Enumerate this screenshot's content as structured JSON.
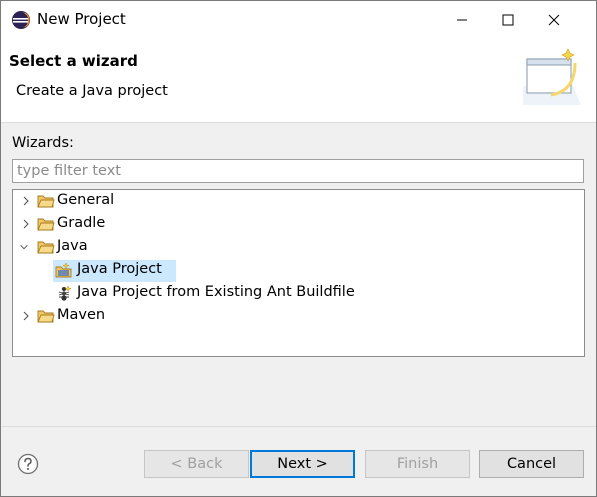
{
  "window": {
    "title": "New Project"
  },
  "banner": {
    "title": "Select a wizard",
    "description": "Create a Java project"
  },
  "wizards": {
    "label": "Wizards:",
    "filter_placeholder": "type filter text",
    "filter_value": "",
    "tree": [
      {
        "label": "General",
        "kind": "folder",
        "expanded": false,
        "icon": "folder-icon"
      },
      {
        "label": "Gradle",
        "kind": "folder",
        "expanded": false,
        "icon": "folder-icon"
      },
      {
        "label": "Java",
        "kind": "folder",
        "expanded": true,
        "icon": "folder-icon"
      },
      {
        "label": "Java Project",
        "kind": "item",
        "selected": true,
        "icon": "java-project-icon"
      },
      {
        "label": "Java Project from Existing Ant Buildfile",
        "kind": "item",
        "selected": false,
        "icon": "ant-icon"
      },
      {
        "label": "Maven",
        "kind": "folder",
        "expanded": false,
        "icon": "folder-icon"
      }
    ]
  },
  "buttons": {
    "back": "< Back",
    "next": "Next >",
    "finish": "Finish",
    "cancel": "Cancel"
  },
  "colors": {
    "selection": "#cce8ff",
    "default_button_border": "#0078d7",
    "folder": "#e8b84a"
  }
}
